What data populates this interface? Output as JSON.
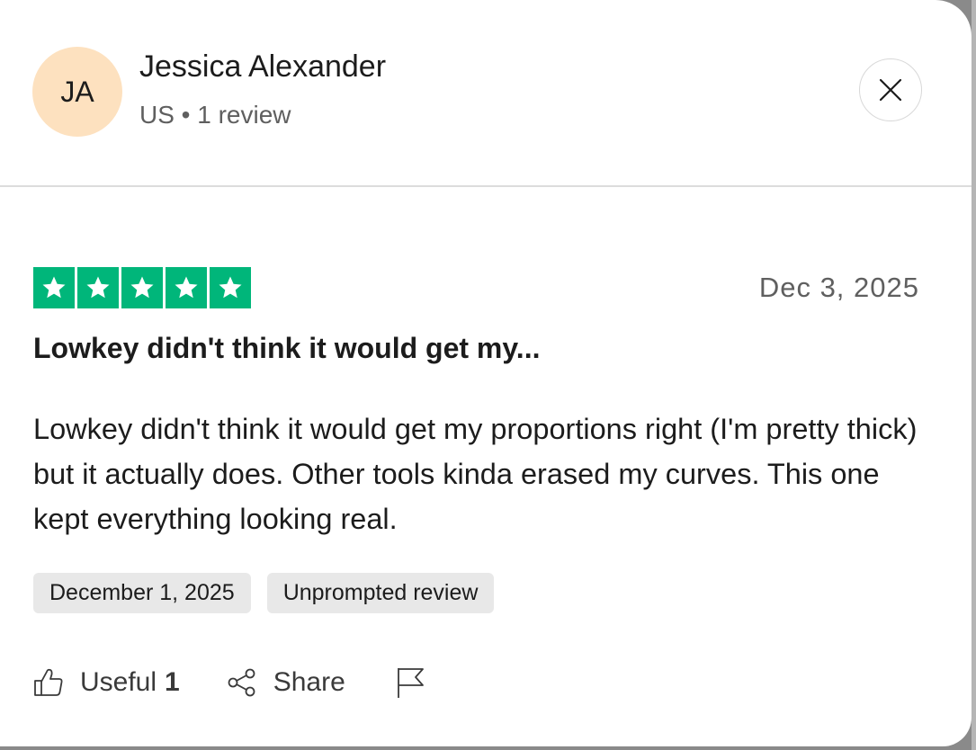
{
  "user": {
    "initials": "JA",
    "name": "Jessica Alexander",
    "meta": "US • 1 review"
  },
  "close": {
    "icon": "close-icon"
  },
  "review": {
    "rating": 5,
    "rating_max": 5,
    "date": "Dec 3, 2025",
    "title": "Lowkey didn't think it would get my...",
    "body": "Lowkey didn't think it would get my proportions right (I'm pretty thick) but it actually does. Other tools kinda erased my curves. This one kept everything looking real.",
    "experience_date": "December 1, 2025",
    "source_label": "Unprompted review"
  },
  "actions": {
    "useful_label": "Useful",
    "useful_count": "1",
    "share_label": "Share",
    "useful_icon": "thumbs-up-icon",
    "share_icon": "share-icon",
    "report_icon": "flag-icon"
  },
  "colors": {
    "star_green": "#00b67a",
    "avatar_bg": "#fde1bf",
    "chip_bg": "#e8e8e8",
    "text": "#1c1c1c",
    "muted_text": "#5f5f5f"
  }
}
